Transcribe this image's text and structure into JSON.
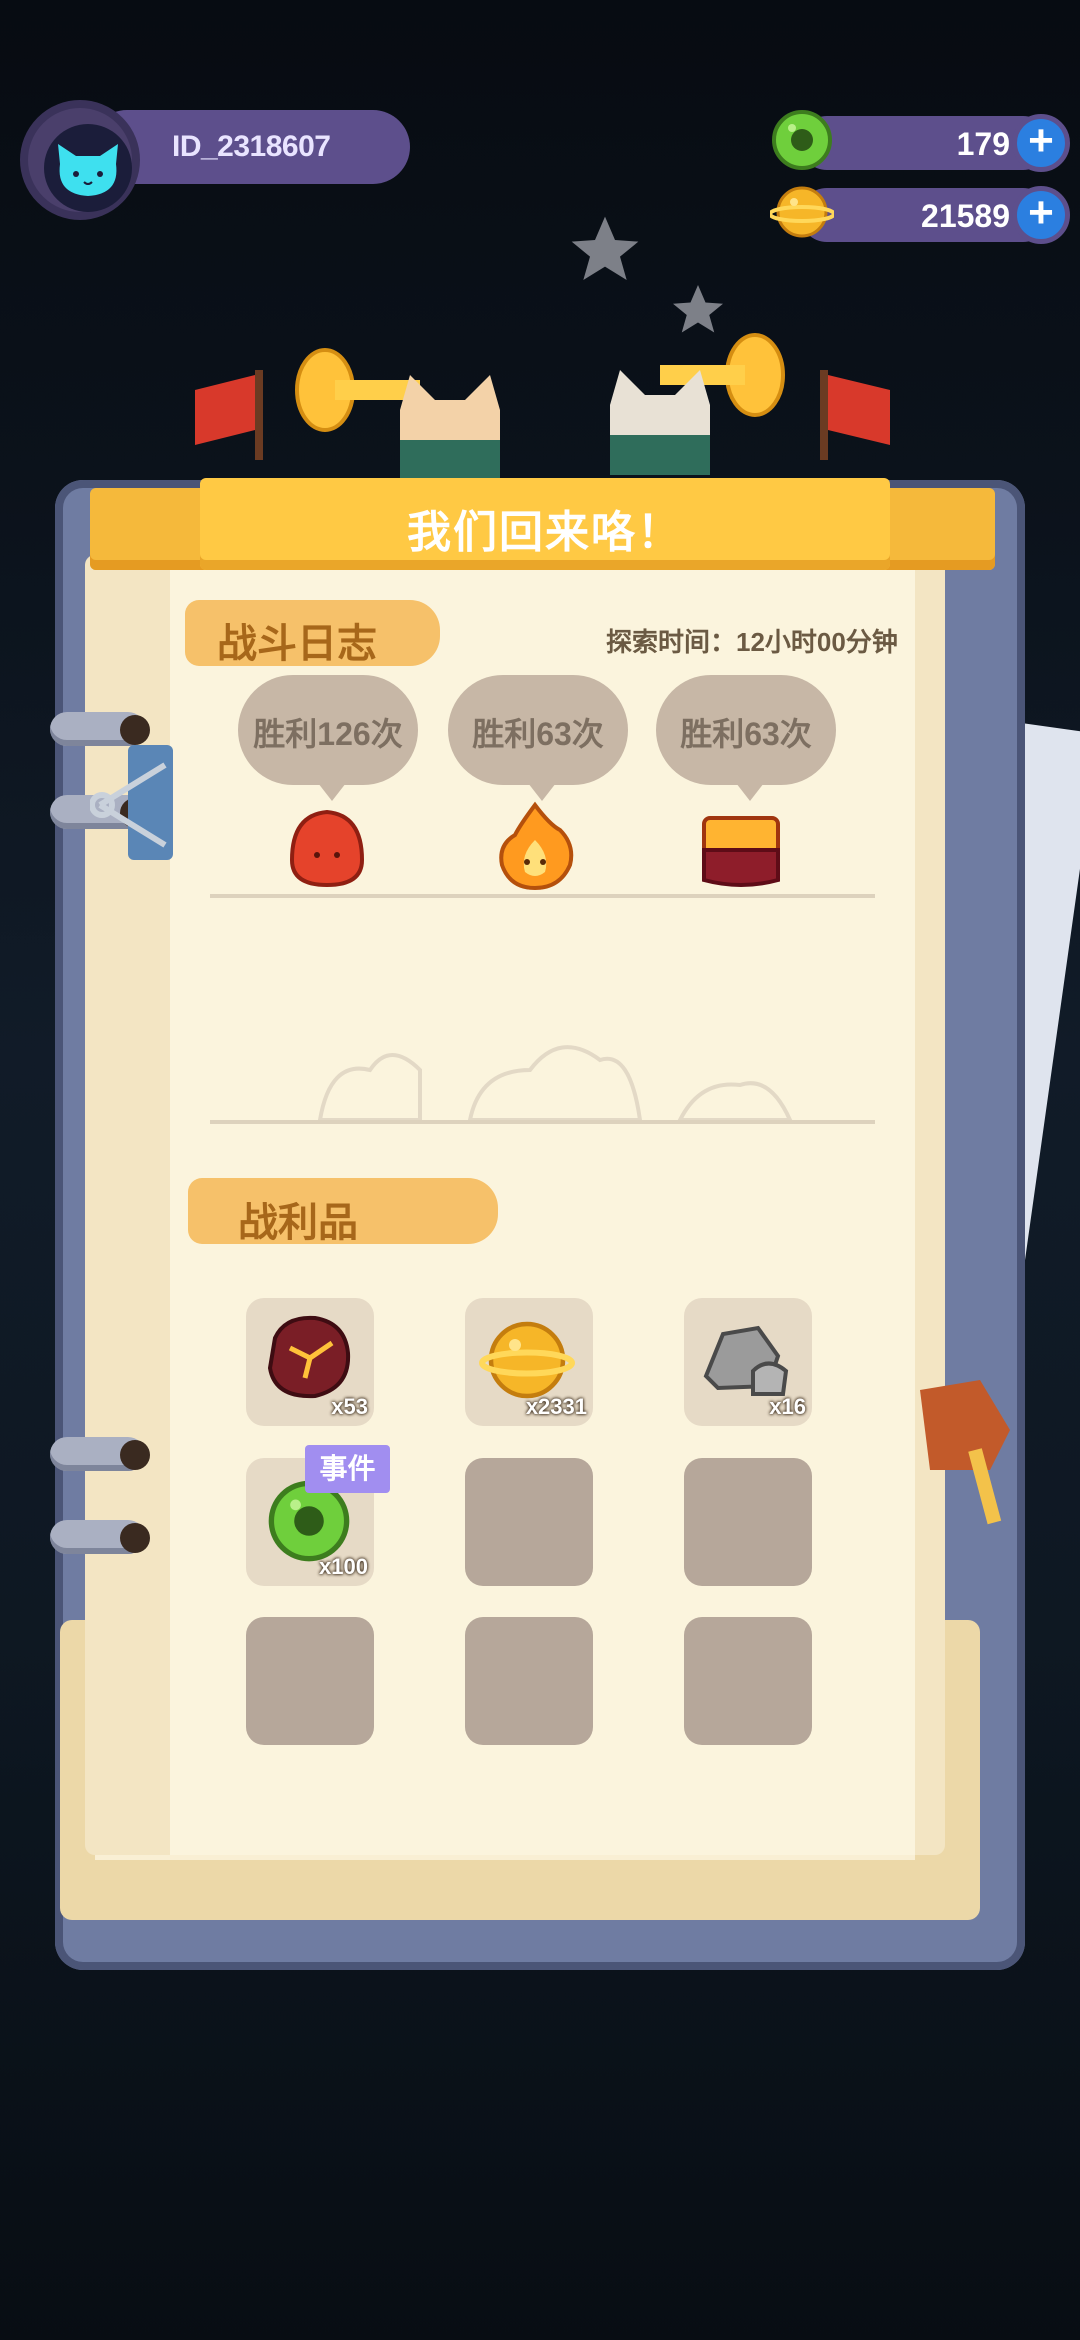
{
  "header": {
    "player_id": "ID_2318607",
    "currencies": [
      {
        "icon": "green-donut-gem-icon",
        "value": "179"
      },
      {
        "icon": "gold-planet-coin-icon",
        "value": "21589"
      }
    ]
  },
  "dialog": {
    "title": "我们回来咯！",
    "battle_log_label": "战斗日志",
    "explore_time": "探索时间：12小时00分钟",
    "wins": [
      {
        "text": "胜利126次",
        "monster": "red-slime-icon"
      },
      {
        "text": "胜利63次",
        "monster": "fire-spirit-icon"
      },
      {
        "text": "胜利63次",
        "monster": "lava-pudding-icon"
      }
    ],
    "loot_label": "战利品",
    "loot": [
      {
        "icon": "magma-rock-icon",
        "qty": "x53"
      },
      {
        "icon": "gold-planet-coin-icon",
        "qty": "x2331"
      },
      {
        "icon": "grey-stone-icon",
        "qty": "x16"
      },
      {
        "icon": "green-donut-gem-icon",
        "qty": "x100",
        "badge": "事件"
      },
      {
        "icon": "",
        "qty": ""
      },
      {
        "icon": "",
        "qty": ""
      },
      {
        "icon": "",
        "qty": ""
      },
      {
        "icon": "",
        "qty": ""
      },
      {
        "icon": "",
        "qty": ""
      }
    ]
  },
  "colors": {
    "ribbon": "#ffc944",
    "tab": "#f6c16a",
    "pill": "#5d4f8c",
    "plus": "#2b7fe0"
  }
}
